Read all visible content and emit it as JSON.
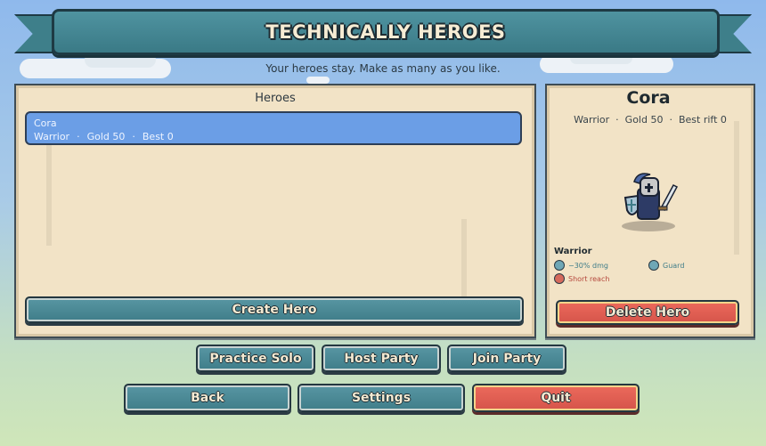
{
  "title": "TECHNICALLY HEROES",
  "subtitle": "Your heroes stay. Make as many as you like.",
  "heroes_panel": {
    "heading": "Heroes",
    "list": [
      {
        "name": "Cora",
        "class": "Warrior",
        "gold": "Gold 50",
        "best": "Best 0",
        "selected": true
      }
    ],
    "create_label": "Create Hero"
  },
  "detail": {
    "name": "Cora",
    "class": "Warrior",
    "gold": "Gold 50",
    "best": "Best rift 0",
    "class_label": "Warrior",
    "traits": [
      {
        "text": "−30% dmg",
        "kind": "good",
        "icon": "shield-icon"
      },
      {
        "text": "Guard",
        "kind": "good",
        "icon": "shield-icon"
      },
      {
        "text": "Short reach",
        "kind": "bad",
        "icon": "sword-icon"
      }
    ],
    "delete_label": "Delete Hero"
  },
  "actions": {
    "practice_solo": "Practice Solo",
    "host_party": "Host Party",
    "join_party": "Join Party",
    "back": "Back",
    "settings": "Settings",
    "quit": "Quit"
  },
  "colors": {
    "teal": "#3f7d89",
    "red": "#d5544a",
    "parchment": "#f2e3c6",
    "selection": "#6b9ee6"
  }
}
